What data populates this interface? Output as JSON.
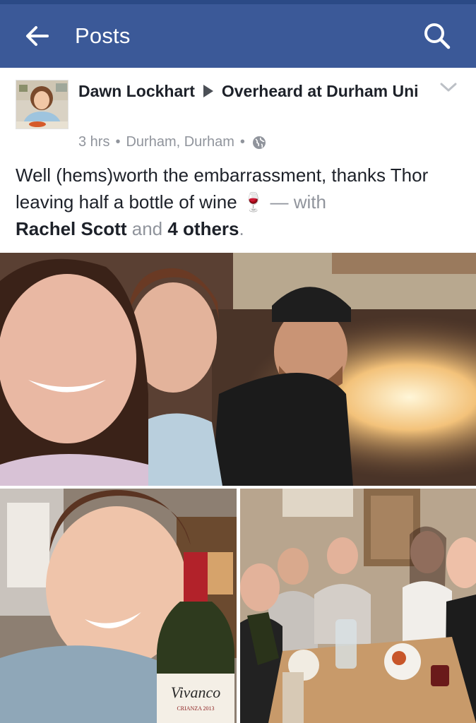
{
  "topbar": {
    "title": "Posts",
    "back_icon": "arrow-left-icon",
    "search_icon": "search-icon",
    "color": "#3b5998"
  },
  "post": {
    "author": "Dawn Lockhart",
    "group": "Overheard at Durham Uni",
    "time": "3 hrs",
    "location": "Durham, Durham",
    "privacy_icon": "globe-icon",
    "text": "Well (hems)worth the embarrassment, thanks Thor leaving half a bottle of wine",
    "emoji": "🍷",
    "with_text": "— with",
    "tagged_person": "Rachel Scott",
    "and_text": "and",
    "others_text": "4 others",
    "period": "."
  },
  "photos": {
    "bottle_label": "Vivanco",
    "bottle_sublabel": "CRIANZA 2013"
  }
}
